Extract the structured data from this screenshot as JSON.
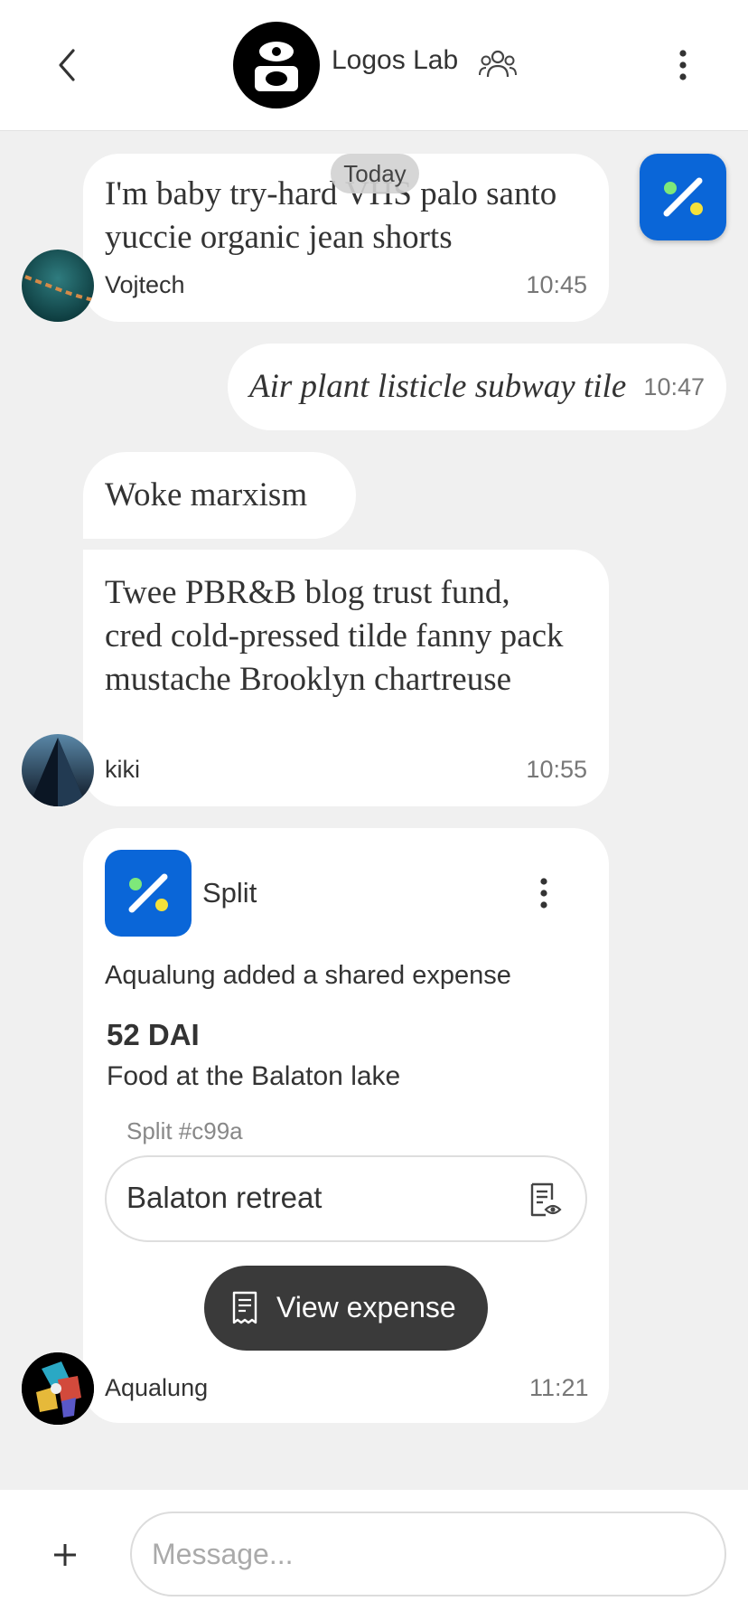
{
  "header": {
    "title": "Logos Lab",
    "back_icon": "chevron-left-icon",
    "members_icon": "people-icon",
    "menu_icon": "more-vertical-icon"
  },
  "date_separator": "Today",
  "messages": [
    {
      "text": "I'm baby try-hard VHS palo santo yuccie organic jean shorts",
      "sender": "Vojtech",
      "time": "10:45"
    },
    {
      "text": "Air plant listicle subway tile",
      "time": "10:47",
      "own": true
    },
    {
      "text": "Woke marxism"
    },
    {
      "text": "Twee PBR&B blog trust fund, cred cold-pressed tilde fanny pack mustache Brooklyn chartreuse",
      "sender": "kiki",
      "time": "10:55"
    }
  ],
  "split_card": {
    "app_name": "Split",
    "description": "Aqualung added a shared expense",
    "amount": "52 DAI",
    "expense_name": "Food at the Balaton lake",
    "split_id": "Split #c99a",
    "group_name": "Balaton retreat",
    "view_button": "View expense",
    "sender": "Aqualung",
    "time": "11:21"
  },
  "composer": {
    "placeholder": "Message...",
    "add_icon": "plus-icon"
  },
  "colors": {
    "split_blue": "#0a66d8",
    "split_green": "#7ee87a",
    "split_yellow": "#f5e13a",
    "dark_button": "#3a3a3a",
    "background": "#f0f0f0"
  }
}
